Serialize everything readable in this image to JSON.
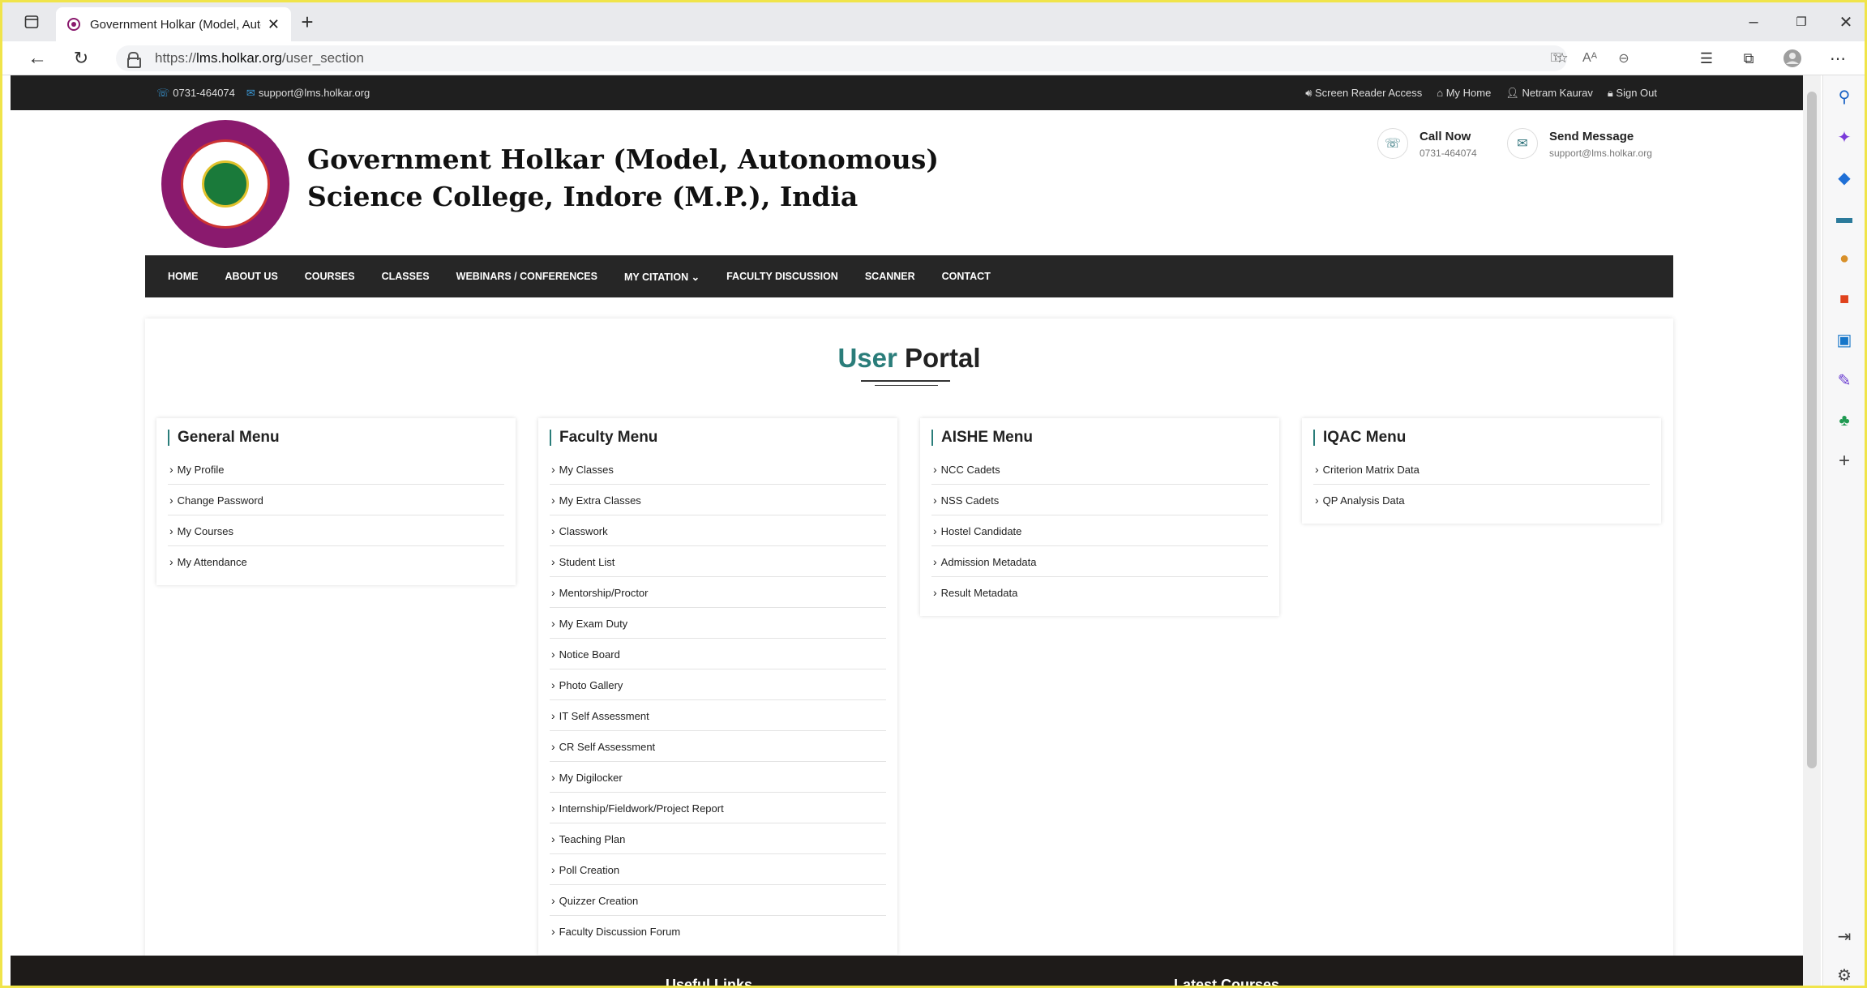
{
  "browser": {
    "tab_title": "Government Holkar (Model, Auto",
    "url_prefix": "https://",
    "url_host": "lms.holkar.org",
    "url_path": "/user_section"
  },
  "topbar": {
    "phone": "0731-464074",
    "email": "support@lms.holkar.org",
    "screen_reader": "Screen Reader Access",
    "my_home": "My Home",
    "user_name": "Netram Kaurav",
    "sign_out": "Sign Out"
  },
  "header": {
    "college_name": "Government Holkar (Model, Autonomous)\nScience College, Indore (M.P.), India",
    "call_title": "Call Now",
    "call_value": "0731-464074",
    "msg_title": "Send Message",
    "msg_value": "support@lms.holkar.org"
  },
  "nav": [
    "HOME",
    "ABOUT US",
    "COURSES",
    "CLASSES",
    "WEBINARS / CONFERENCES",
    "MY CITATION ⌄",
    "FACULTY DISCUSSION",
    "SCANNER",
    "CONTACT"
  ],
  "portal": {
    "title_highlight": "User",
    "title_rest": " Portal",
    "menus": [
      {
        "title": "General Menu",
        "items": [
          "My Profile",
          "Change Password",
          "My Courses",
          "My Attendance"
        ]
      },
      {
        "title": "Faculty Menu",
        "items": [
          "My Classes",
          "My Extra Classes",
          "Classwork",
          "Student List",
          "Mentorship/Proctor",
          "My Exam Duty",
          "Notice Board",
          "Photo Gallery",
          "IT Self Assessment",
          "CR Self Assessment",
          "My Digilocker",
          "Internship/Fieldwork/Project Report",
          "Teaching Plan",
          "Poll Creation",
          "Quizzer Creation",
          "Faculty Discussion Forum"
        ]
      },
      {
        "title": "AISHE Menu",
        "items": [
          "NCC Cadets",
          "NSS Cadets",
          "Hostel Candidate",
          "Admission Metadata",
          "Result Metadata"
        ]
      },
      {
        "title": "IQAC Menu",
        "items": [
          "Criterion Matrix Data",
          "QP Analysis Data"
        ]
      }
    ]
  },
  "footer": {
    "useful_links": "Useful Links",
    "latest_courses": "Latest Courses"
  },
  "colors": {
    "accent": "#2a7d7a",
    "dark": "#262626",
    "logo": "#8a1a6e"
  }
}
